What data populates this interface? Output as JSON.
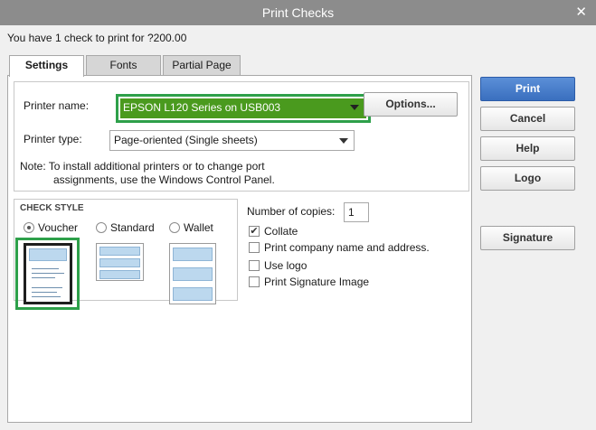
{
  "window": {
    "title": "Print Checks",
    "close_glyph": "✕"
  },
  "summary": "You have 1 check to print for ?200.00",
  "tabs": [
    {
      "label": "Settings",
      "active": true
    },
    {
      "label": "Fonts",
      "active": false
    },
    {
      "label": "Partial Page",
      "active": false
    }
  ],
  "printer": {
    "name_label": "Printer name:",
    "name_value": "EPSON L120 Series on USB003",
    "type_label": "Printer type:",
    "type_value": "Page-oriented (Single sheets)",
    "options_label": "Options...",
    "note_line1": "Note: To install additional printers or to change port",
    "note_line2": "assignments, use the Windows Control Panel."
  },
  "check_style": {
    "heading": "CHECK STYLE",
    "options": [
      {
        "label": "Voucher",
        "selected": true
      },
      {
        "label": "Standard",
        "selected": false
      },
      {
        "label": "Wallet",
        "selected": false
      }
    ]
  },
  "copies": {
    "label": "Number of copies:",
    "value": "1"
  },
  "checkboxes": [
    {
      "label": "Collate",
      "checked": true
    },
    {
      "label": "Print company name and address.",
      "checked": false
    },
    {
      "label": "Use logo",
      "checked": false
    },
    {
      "label": "Print Signature Image",
      "checked": false
    }
  ],
  "buttons": {
    "print": "Print",
    "cancel": "Cancel",
    "help": "Help",
    "logo": "Logo",
    "signature": "Signature"
  },
  "colors": {
    "highlight_green": "#2ea04a",
    "printer_fill": "#4a9a1e",
    "primary_button": "#3a6fbf",
    "titlebar": "#8c8c8c"
  },
  "checkmark_glyph": "✔"
}
